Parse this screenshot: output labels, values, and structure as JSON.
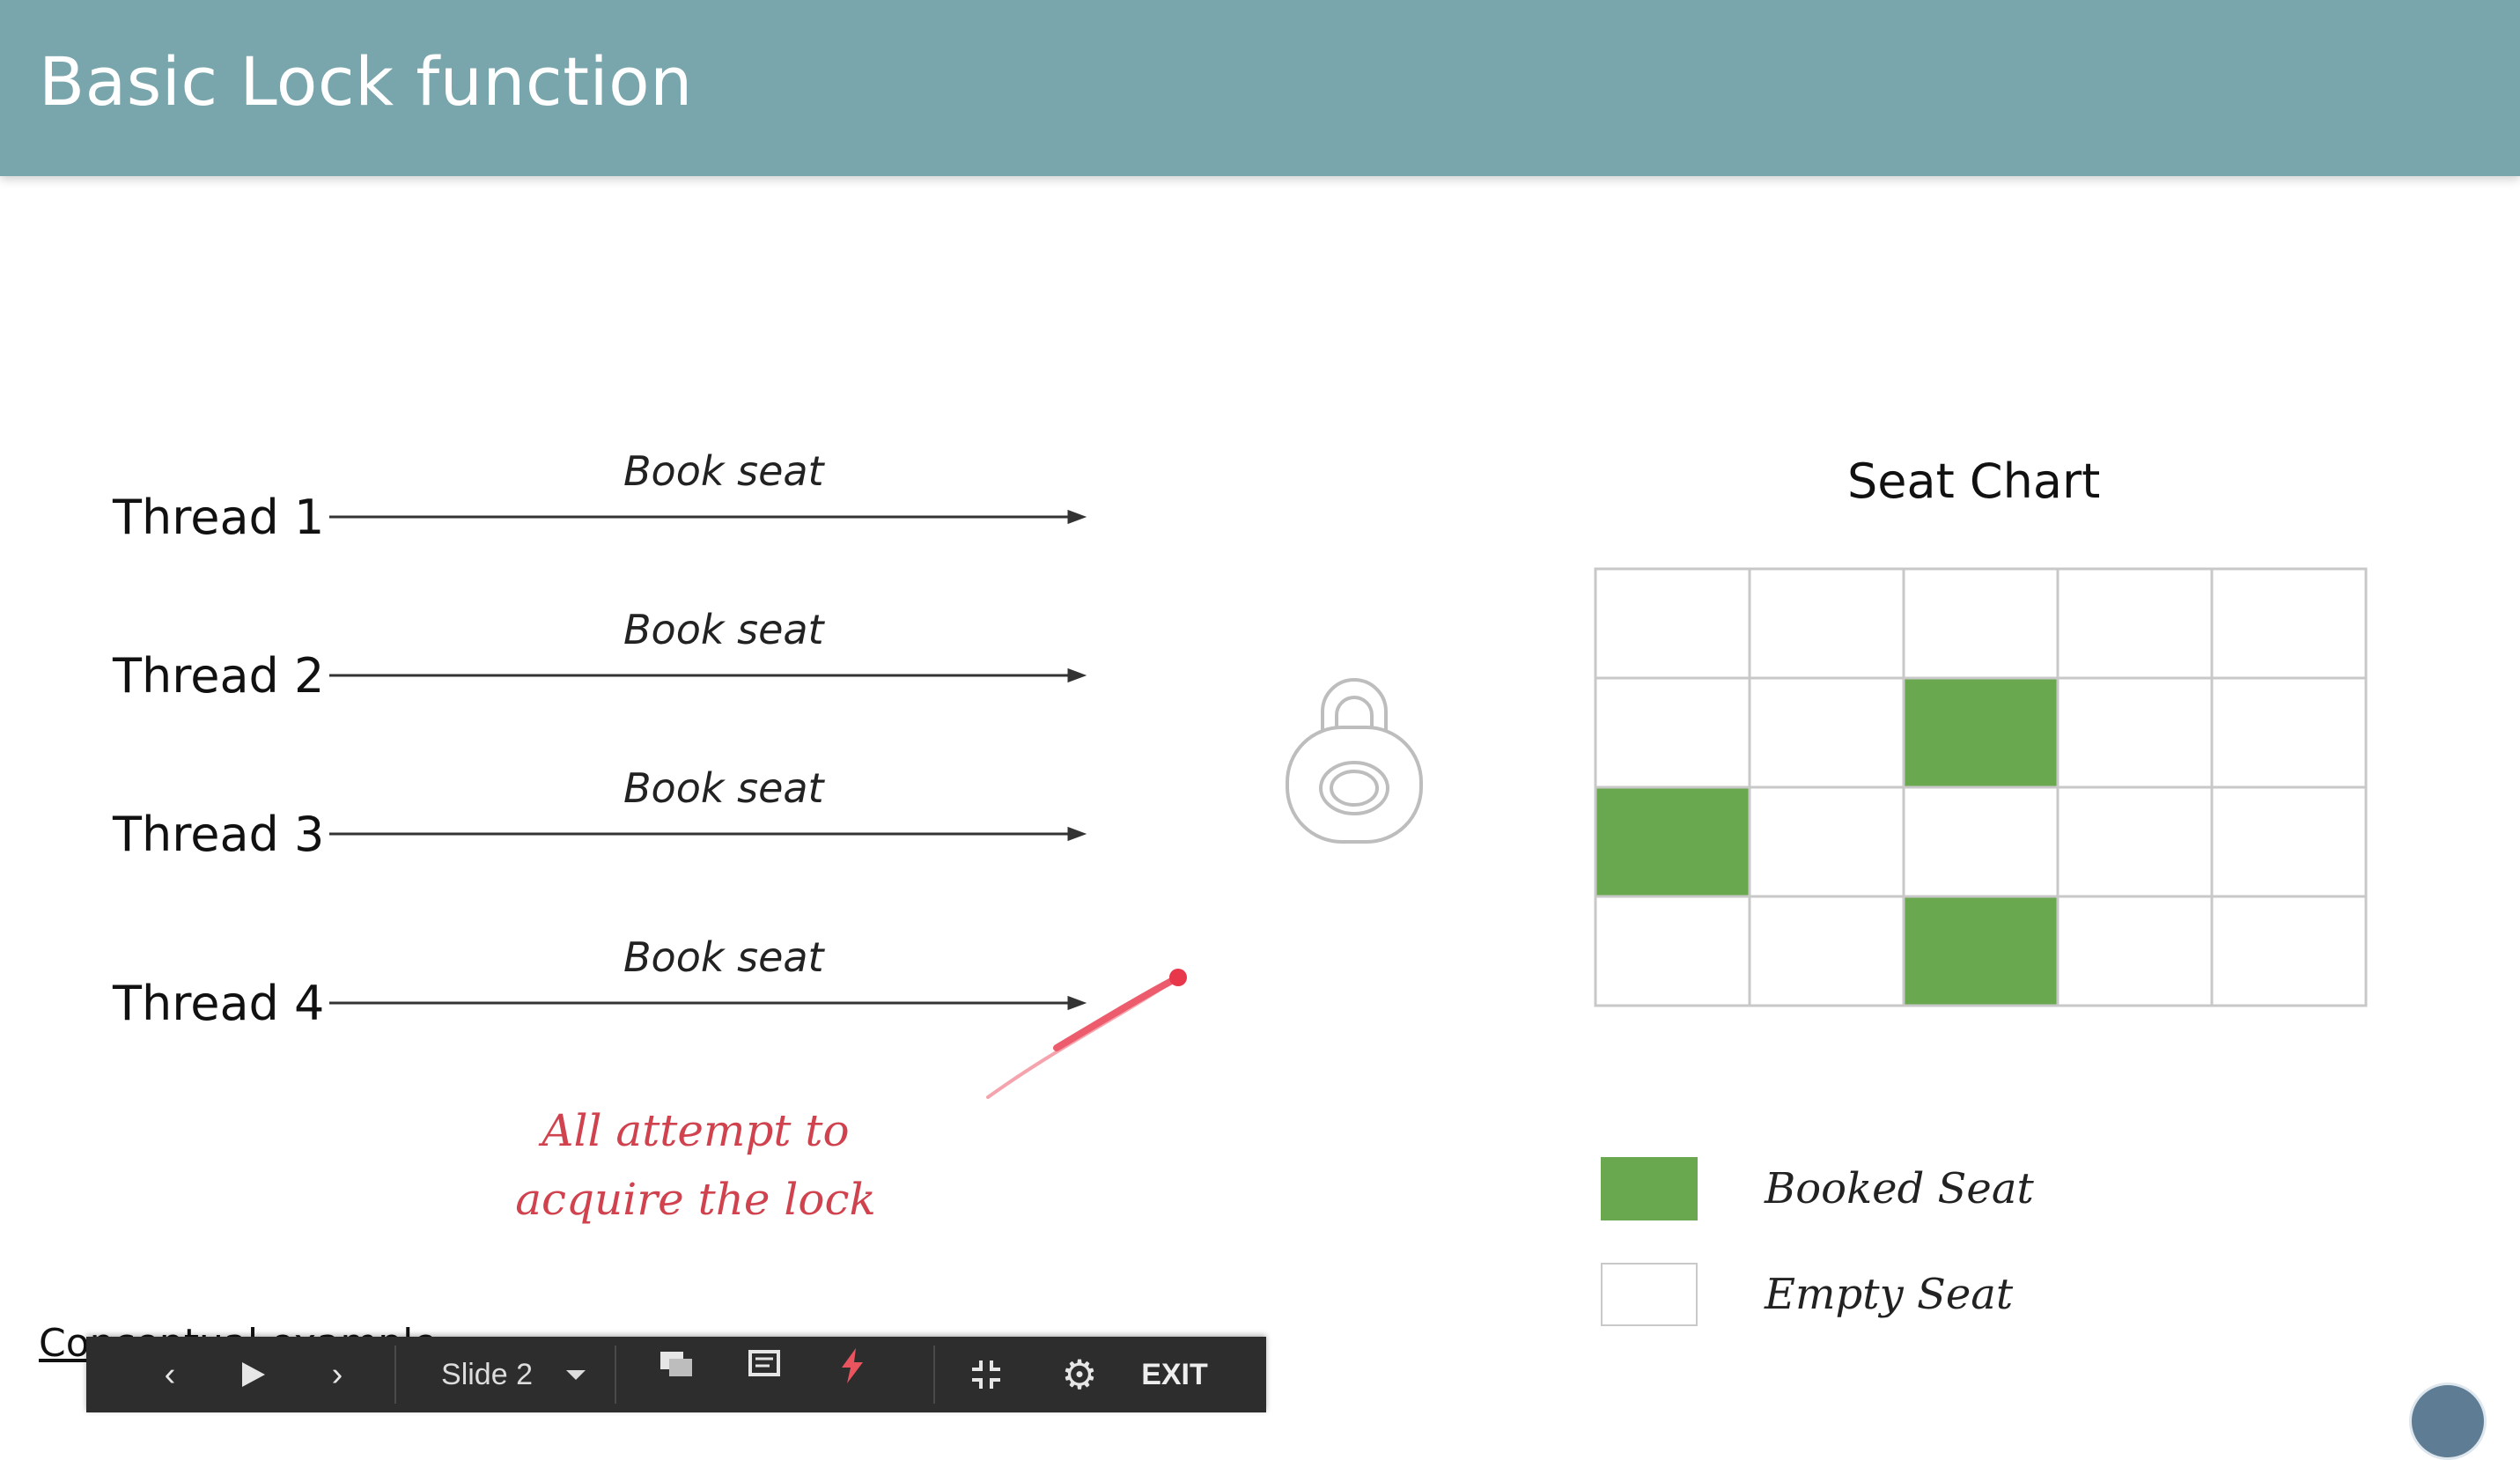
{
  "slide": {
    "title": "Basic Lock function",
    "threads": [
      {
        "label": "Thread 1",
        "action": "Book seat"
      },
      {
        "label": "Thread 2",
        "action": "Book seat"
      },
      {
        "label": "Thread 3",
        "action": "Book seat"
      },
      {
        "label": "Thread 4",
        "action": "Book seat"
      }
    ],
    "annotation": {
      "line1": "All attempt to",
      "line2": "acquire the lock"
    },
    "seat_chart": {
      "title": "Seat Chart",
      "rows": 4,
      "cols": 5,
      "booked": [
        [
          1,
          2
        ],
        [
          2,
          0
        ],
        [
          3,
          2
        ]
      ],
      "booked_color": "#6aa84f",
      "empty_color": "#ffffff"
    },
    "legend": {
      "booked": "Booked Seat",
      "empty": "Empty Seat"
    },
    "footer": "Conceptual example"
  },
  "toolbar": {
    "slide_label": "Slide 2",
    "exit_label": "EXIT",
    "icons": [
      "prev-icon",
      "play-icon",
      "next-icon",
      "dropdown-icon",
      "qa-icon",
      "notes-icon",
      "pointer-icon",
      "exit-fullscreen-icon",
      "settings-icon"
    ]
  },
  "colors": {
    "header": "#79a6ac",
    "accent_red": "#d0434e",
    "toolbar": "#2d2d2d"
  }
}
